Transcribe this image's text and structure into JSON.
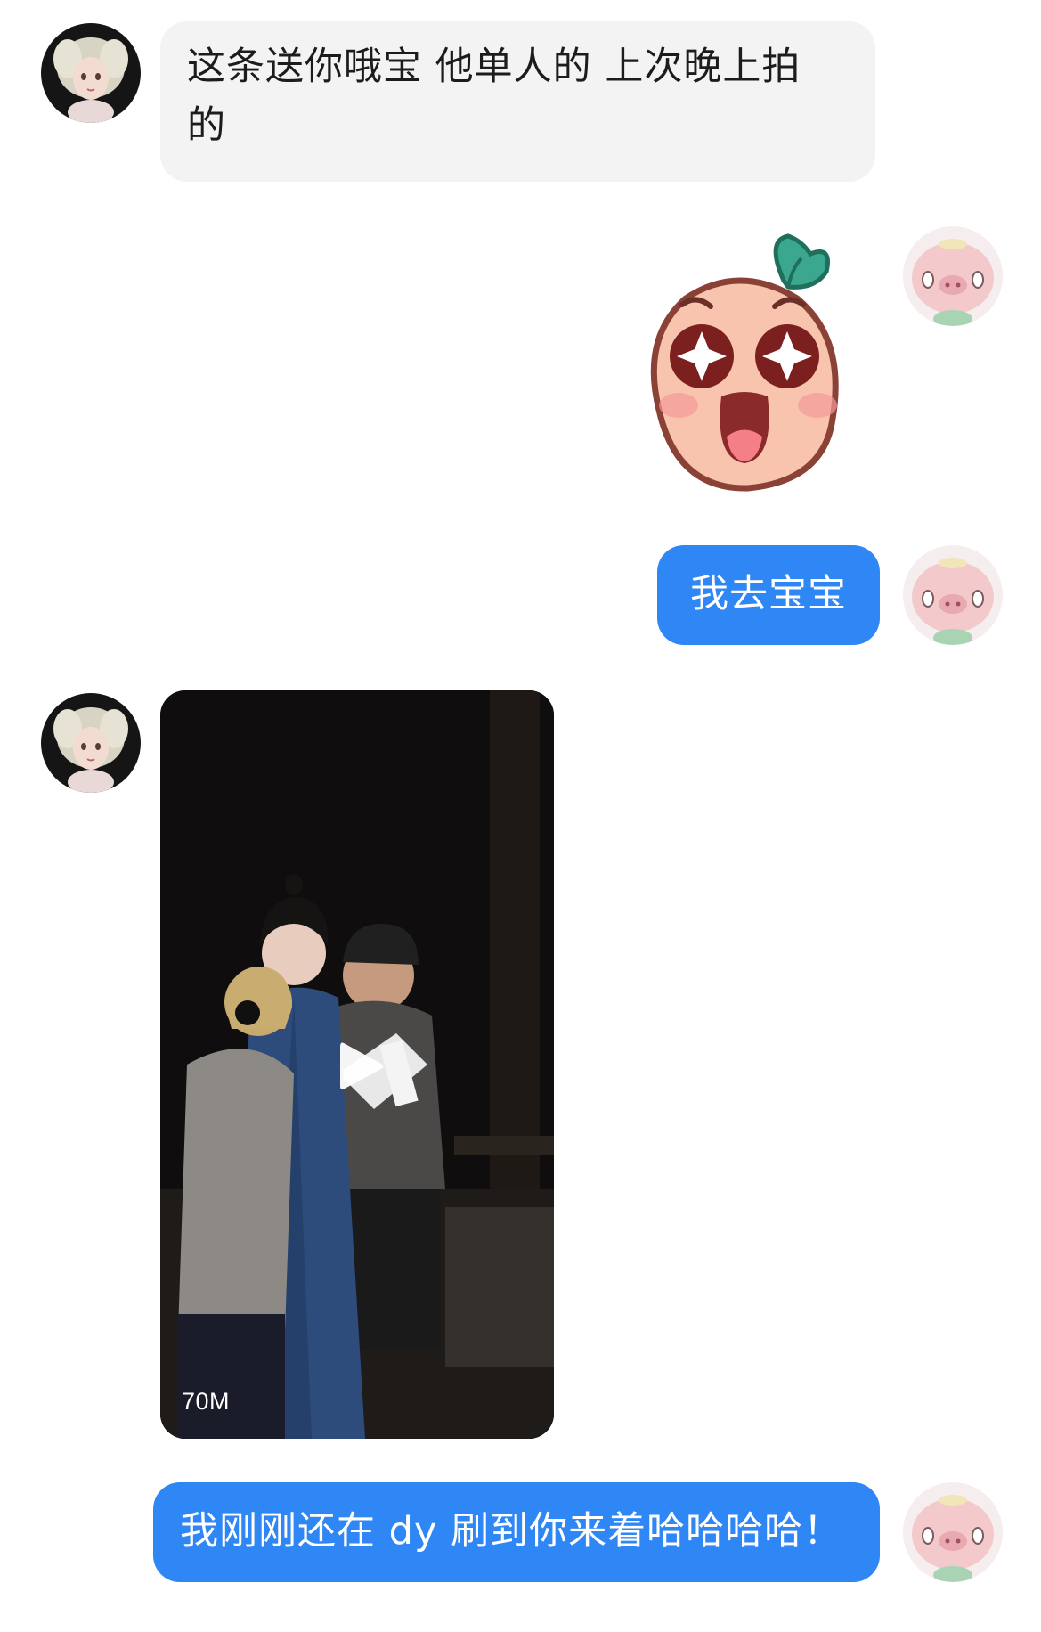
{
  "messages": [
    {
      "side": "in",
      "type": "text",
      "line1": "这条送你哦宝 他单人的 上次晚上拍",
      "line2": "的"
    },
    {
      "side": "out",
      "type": "sticker",
      "sticker_icon": "peach-starry-eyes-sticker"
    },
    {
      "side": "out",
      "type": "text",
      "text": "我去宝宝"
    },
    {
      "side": "in",
      "type": "video",
      "size_label": "70M"
    },
    {
      "side": "out",
      "type": "text",
      "text": "我刚刚还在 dy 刷到你来着哈哈哈哈！"
    }
  ],
  "colors": {
    "outgoing_bubble": "#2f86f5",
    "incoming_bubble": "#f3f3f3",
    "background": "#ffffff"
  },
  "avatars": {
    "contact": "doll-girl-avatar-icon",
    "self": "pink-pig-avatar-icon"
  }
}
